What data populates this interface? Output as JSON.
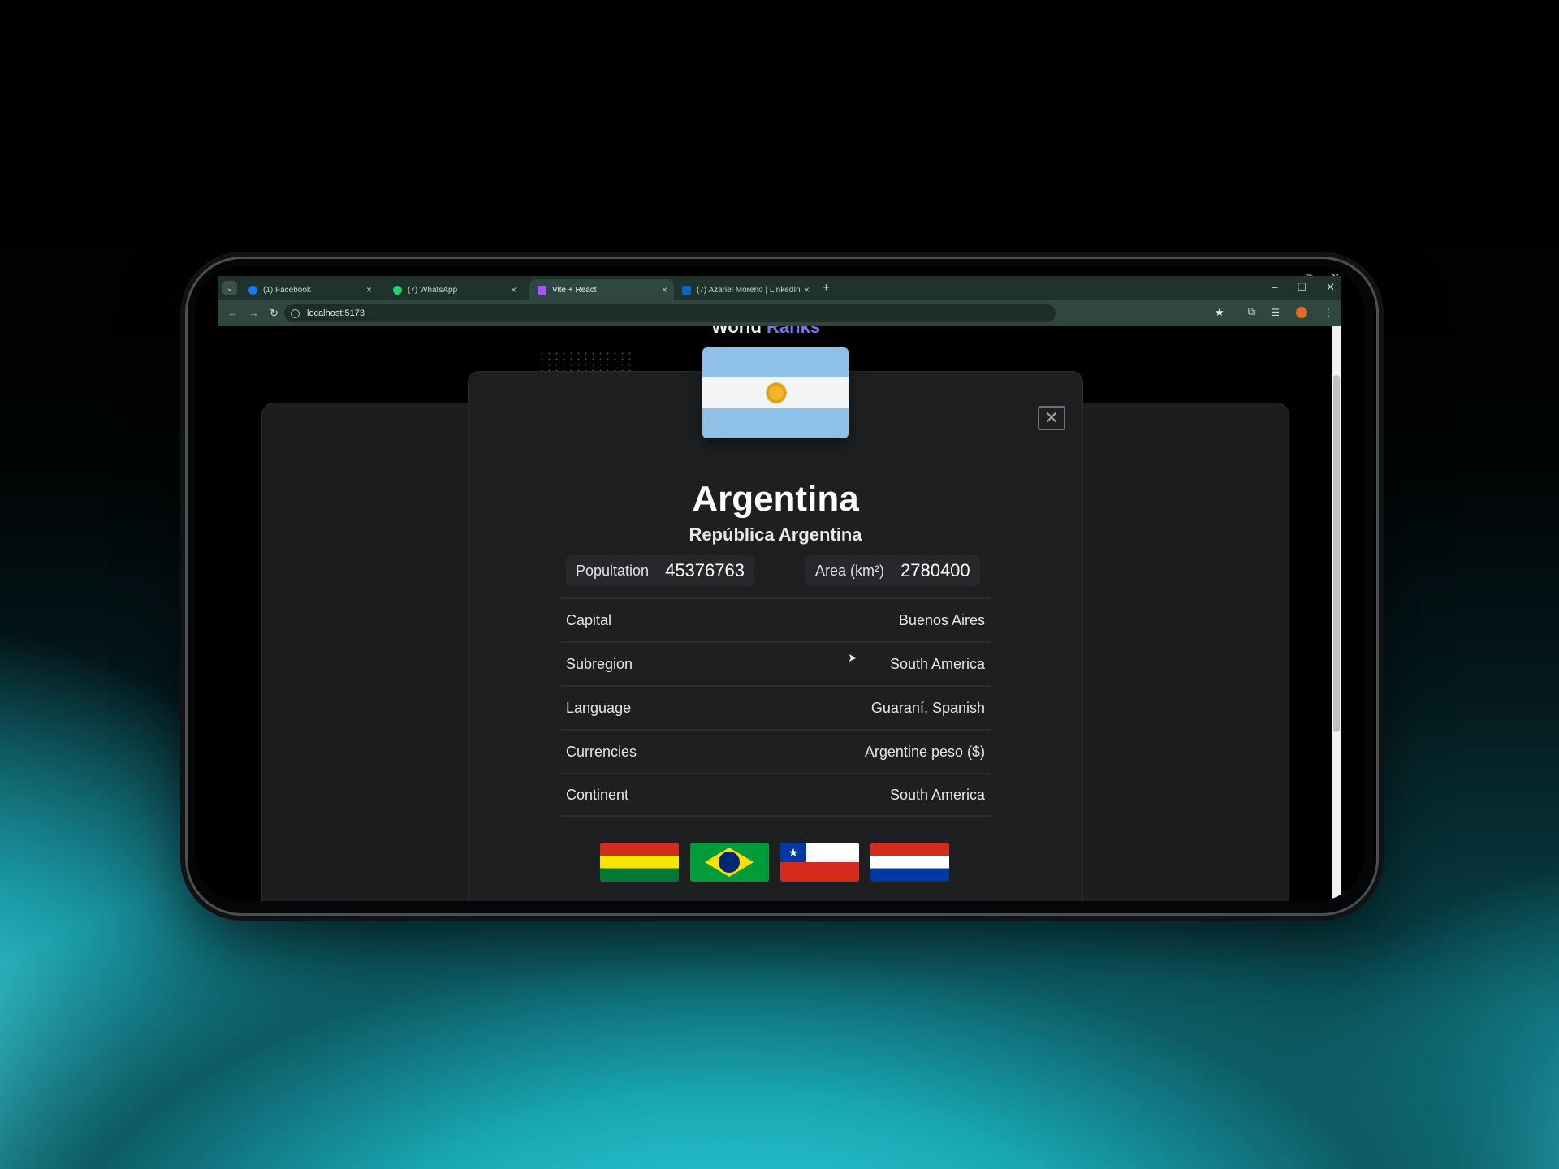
{
  "phone_sys": {
    "minimize": "–",
    "restore": "⧉",
    "close": "✕"
  },
  "browser": {
    "tab_dropdown": "⌄",
    "tabs": [
      {
        "title": "(1) Facebook",
        "favicon_color": "#1877f2",
        "close": "×"
      },
      {
        "title": "(7) WhatsApp",
        "favicon_color": "#25d366",
        "close": "×"
      },
      {
        "title": "Vite + React",
        "favicon_color": "#a855f7",
        "close": "×"
      },
      {
        "title": "(7) Azariel Moreno | LinkedIn",
        "favicon_color": "#0a66c2",
        "close": "×"
      }
    ],
    "new_tab": "+",
    "window": {
      "minimize": "–",
      "maximize": "☐",
      "close": "✕"
    },
    "nav": {
      "back": "←",
      "forward": "→",
      "reload": "↻"
    },
    "url": "localhost:5173",
    "bookmark_icon": "★",
    "toolbar_right": {
      "extensions": "⧉",
      "media": "☰",
      "menu": "⋮"
    }
  },
  "app": {
    "title_part1": "World",
    "title_part2": "Ranks"
  },
  "country": {
    "name": "Argentina",
    "official_name": "República Argentina",
    "population_label": "Popultation",
    "population": "45376763",
    "area_label": "Area (km²)",
    "area": "2780400",
    "details": [
      {
        "label": "Capital",
        "value": "Buenos Aires"
      },
      {
        "label": "Subregion",
        "value": "South America"
      },
      {
        "label": "Language",
        "value": "Guaraní, Spanish"
      },
      {
        "label": "Currencies",
        "value": "Argentine peso ($)"
      },
      {
        "label": "Continent",
        "value": "South America"
      }
    ],
    "close_label": "✕"
  },
  "colors": {
    "accent": "#6f7ae8",
    "modal_bg": "#1e1f21",
    "tabbar": "#20322c"
  }
}
